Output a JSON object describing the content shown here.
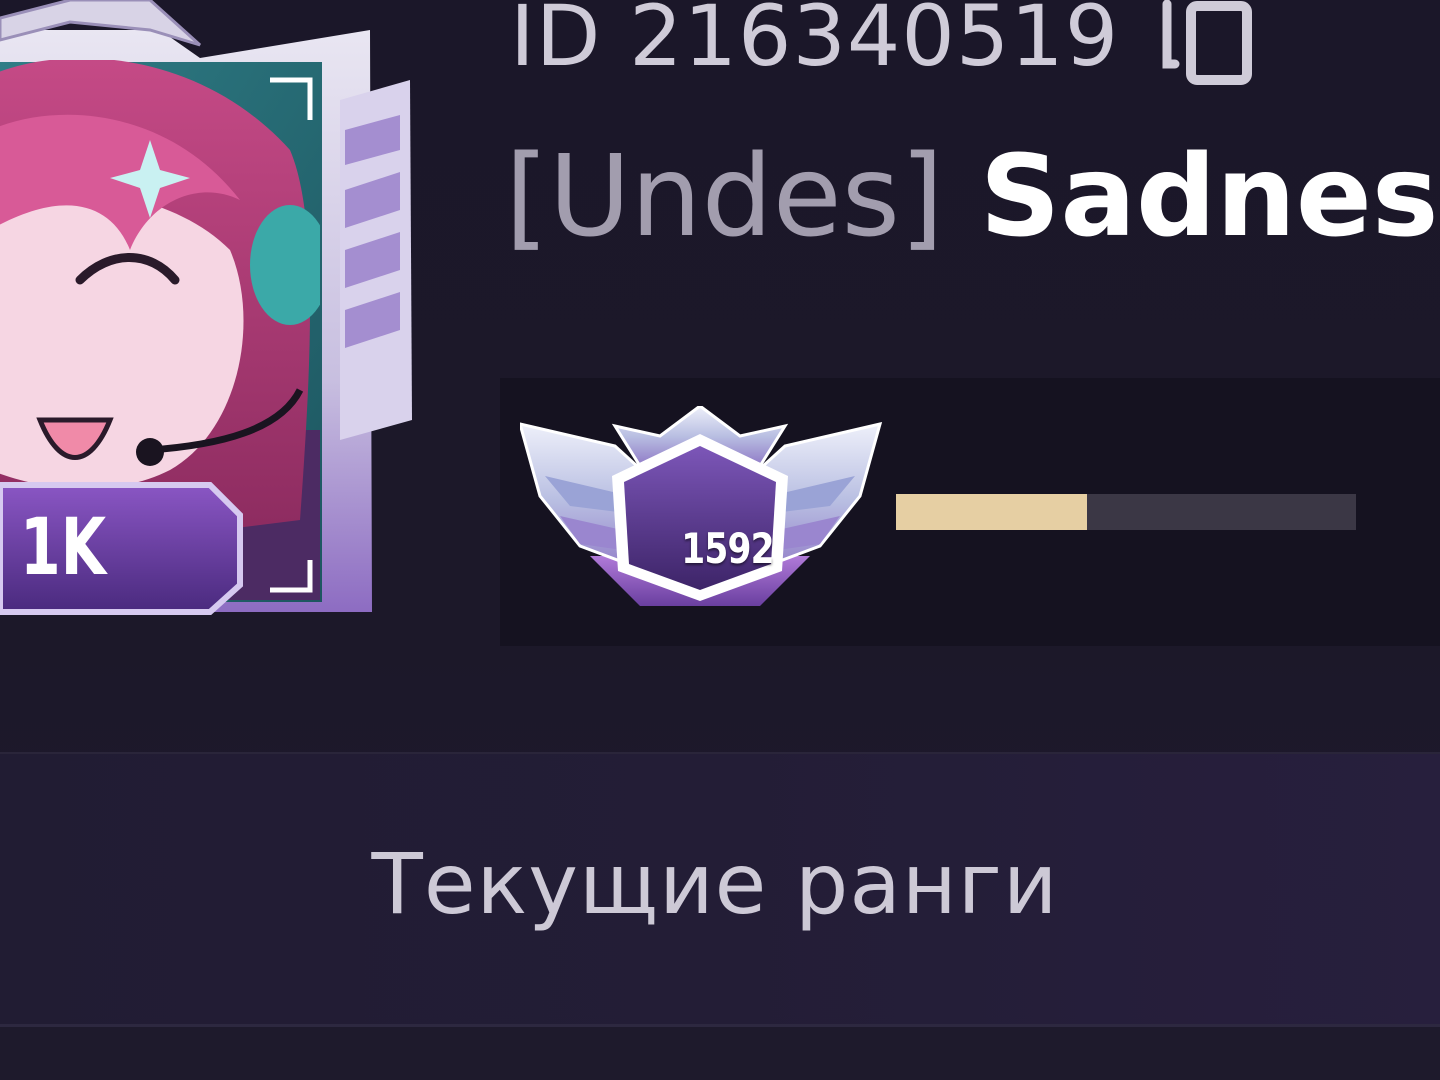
{
  "profile": {
    "id_text": "ID 216340519",
    "clan_tag": "[Undes]",
    "nickname": "Sadnes",
    "avatar_badge": "1K"
  },
  "rating": {
    "value": "1592",
    "progress_fraction": 0.415
  },
  "section": {
    "title": "Текущие ранги"
  },
  "icons": {
    "copy": "copy-icon",
    "rank": "rank-emblem-icon"
  },
  "colors": {
    "background": "#1b1729",
    "progress_fill": "#e6cfa3",
    "progress_track": "#3b3745",
    "accent_purple": "#6a3fa0"
  }
}
